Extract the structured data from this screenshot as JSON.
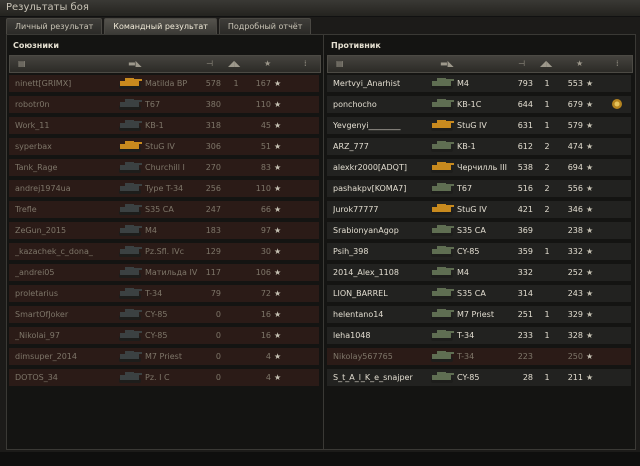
{
  "window": {
    "title": "Результаты боя"
  },
  "tabs": [
    {
      "label": "Личный результат",
      "active": false
    },
    {
      "label": "Командный результат",
      "active": true
    },
    {
      "label": "Подробный отчёт",
      "active": false
    }
  ],
  "allies": {
    "title": "Союзники",
    "rows": [
      {
        "player": "ninett[GRIMX]",
        "vehicle": "Matilda BP",
        "damage": "578",
        "frags": "1",
        "xp": "167",
        "alive": false,
        "icon": "gold"
      },
      {
        "player": "robotr0n",
        "vehicle": "T67",
        "damage": "380",
        "frags": "",
        "xp": "110",
        "alive": false,
        "icon": "dark"
      },
      {
        "player": "Work_11",
        "vehicle": "KB-1",
        "damage": "318",
        "frags": "",
        "xp": "45",
        "alive": false,
        "icon": "dark"
      },
      {
        "player": "syperbax",
        "vehicle": "StuG IV",
        "damage": "306",
        "frags": "",
        "xp": "51",
        "alive": false,
        "icon": "gold"
      },
      {
        "player": "Tank_Rage",
        "vehicle": "Churchill I",
        "damage": "270",
        "frags": "",
        "xp": "83",
        "alive": false,
        "icon": "dark"
      },
      {
        "player": "andrej1974ua",
        "vehicle": "Type T-34",
        "damage": "256",
        "frags": "",
        "xp": "110",
        "alive": false,
        "icon": "dark"
      },
      {
        "player": "Trefle",
        "vehicle": "S35 CA",
        "damage": "247",
        "frags": "",
        "xp": "66",
        "alive": false,
        "icon": "dark"
      },
      {
        "player": "ZeGun_2015",
        "vehicle": "M4",
        "damage": "183",
        "frags": "",
        "xp": "97",
        "alive": false,
        "icon": "dark"
      },
      {
        "player": "_kazachek_c_dona_",
        "vehicle": "Pz.Sfl. IVc",
        "damage": "129",
        "frags": "",
        "xp": "30",
        "alive": false,
        "icon": "dark"
      },
      {
        "player": "_andrei05",
        "vehicle": "Матильда IV",
        "damage": "117",
        "frags": "",
        "xp": "106",
        "alive": false,
        "icon": "dark"
      },
      {
        "player": "proletarius",
        "vehicle": "T-34",
        "damage": "79",
        "frags": "",
        "xp": "72",
        "alive": false,
        "icon": "dark"
      },
      {
        "player": "SmartOfJoker",
        "vehicle": "CY-85",
        "damage": "0",
        "frags": "",
        "xp": "16",
        "alive": false,
        "icon": "dark"
      },
      {
        "player": "_Nikolai_97",
        "vehicle": "CY-85",
        "damage": "0",
        "frags": "",
        "xp": "16",
        "alive": false,
        "icon": "dark"
      },
      {
        "player": "dimsuper_2014",
        "vehicle": "M7 Priest",
        "damage": "0",
        "frags": "",
        "xp": "4",
        "alive": false,
        "icon": "dark"
      },
      {
        "player": "DOTOS_34",
        "vehicle": "Pz. I C",
        "damage": "0",
        "frags": "",
        "xp": "4",
        "alive": false,
        "icon": "dark"
      }
    ]
  },
  "enemies": {
    "title": "Противник",
    "rows": [
      {
        "player": "Mertvyi_Anarhist",
        "vehicle": "M4",
        "damage": "793",
        "frags": "1",
        "xp": "553",
        "alive": true,
        "icon": "green"
      },
      {
        "player": "ponchocho",
        "vehicle": "KB-1C",
        "damage": "644",
        "frags": "1",
        "xp": "679",
        "alive": true,
        "icon": "green",
        "medal": true
      },
      {
        "player": "Yevgenyi________",
        "vehicle": "StuG IV",
        "damage": "631",
        "frags": "1",
        "xp": "579",
        "alive": true,
        "icon": "gold"
      },
      {
        "player": "ARZ_777",
        "vehicle": "KB-1",
        "damage": "612",
        "frags": "2",
        "xp": "474",
        "alive": true,
        "icon": "green"
      },
      {
        "player": "alexkr2000[ADQT]",
        "vehicle": "Черчилль III",
        "damage": "538",
        "frags": "2",
        "xp": "694",
        "alive": true,
        "icon": "gold"
      },
      {
        "player": "pashakpv[KOMA7]",
        "vehicle": "T67",
        "damage": "516",
        "frags": "2",
        "xp": "556",
        "alive": true,
        "icon": "green"
      },
      {
        "player": "Jurok77777",
        "vehicle": "StuG IV",
        "damage": "421",
        "frags": "2",
        "xp": "346",
        "alive": true,
        "icon": "gold"
      },
      {
        "player": "SrabionyanAgop",
        "vehicle": "S35 CA",
        "damage": "369",
        "frags": "",
        "xp": "238",
        "alive": true,
        "icon": "green"
      },
      {
        "player": "Psih_398",
        "vehicle": "CY-85",
        "damage": "359",
        "frags": "1",
        "xp": "332",
        "alive": true,
        "icon": "green"
      },
      {
        "player": "2014_Alex_1108",
        "vehicle": "M4",
        "damage": "332",
        "frags": "",
        "xp": "252",
        "alive": true,
        "icon": "green"
      },
      {
        "player": "LION_BARREL",
        "vehicle": "S35 CA",
        "damage": "314",
        "frags": "",
        "xp": "243",
        "alive": true,
        "icon": "green"
      },
      {
        "player": "helentano14",
        "vehicle": "M7 Priest",
        "damage": "251",
        "frags": "1",
        "xp": "329",
        "alive": true,
        "icon": "green"
      },
      {
        "player": "leha1048",
        "vehicle": "T-34",
        "damage": "233",
        "frags": "1",
        "xp": "328",
        "alive": true,
        "icon": "green"
      },
      {
        "player": "Nikolay567765",
        "vehicle": "T-34",
        "damage": "223",
        "frags": "",
        "xp": "250",
        "alive": false,
        "icon": "green"
      },
      {
        "player": "S_t_A_l_K_e_snajper",
        "vehicle": "CY-85",
        "damage": "28",
        "frags": "1",
        "xp": "211",
        "alive": true,
        "icon": "green"
      }
    ]
  },
  "colors": {
    "dead_row": "#2b1b17",
    "alive_row": "#222220",
    "gold_tank": "#c88a1e",
    "green_tank": "#5f6e52",
    "dark_tank": "#3b4142"
  }
}
